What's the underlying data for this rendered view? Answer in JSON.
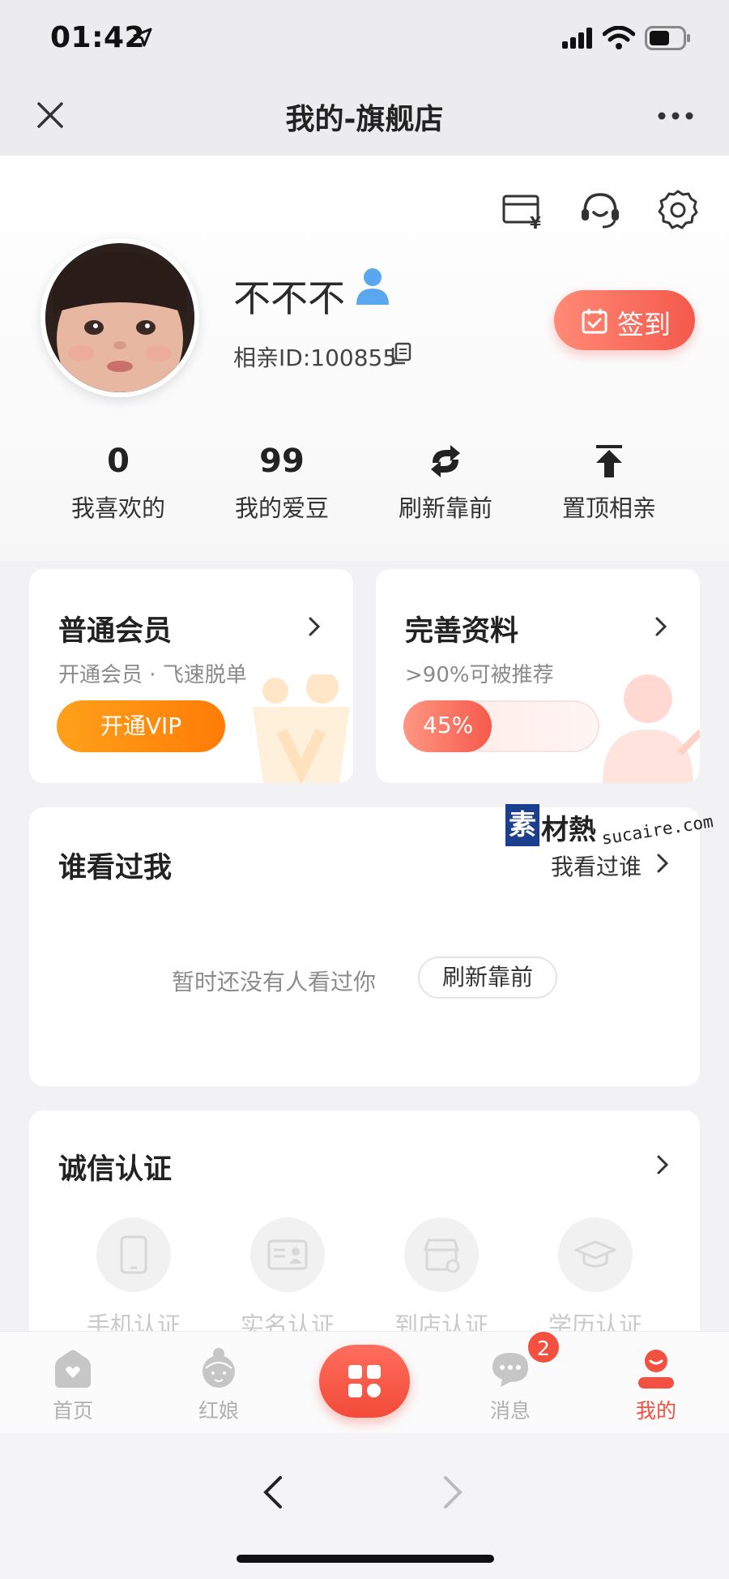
{
  "status_bar": {
    "time": "01:42"
  },
  "nav": {
    "title": "我的-旗舰店"
  },
  "profile": {
    "nickname": "不不不",
    "member_id": "相亲ID:100855",
    "checkin_label": "签到"
  },
  "stats": [
    {
      "value": "0",
      "label": "我喜欢的"
    },
    {
      "value": "99",
      "label": "我的爱豆"
    },
    {
      "icon": "refresh-icon",
      "label": "刷新靠前"
    },
    {
      "icon": "pin-top-icon",
      "label": "置顶相亲"
    }
  ],
  "membership_card": {
    "title": "普通会员",
    "subtitle": "开通会员 · 飞速脱单",
    "button": "开通VIP"
  },
  "profile_card": {
    "title": "完善资料",
    "subtitle": ">90%可被推荐",
    "progress_text": "45%",
    "progress_value": 0.45
  },
  "visitors": {
    "title": "谁看过我",
    "link": "我看过谁",
    "empty_text": "暂时还没有人看过你",
    "refresh_button": "刷新靠前"
  },
  "certification": {
    "title": "诚信认证",
    "items": [
      {
        "label": "手机认证",
        "icon": "phone-icon"
      },
      {
        "label": "实名认证",
        "icon": "id-card-icon"
      },
      {
        "label": "到店认证",
        "icon": "store-icon"
      },
      {
        "label": "学历认证",
        "icon": "graduation-cap-icon"
      }
    ]
  },
  "watermark": {
    "box": "素",
    "text": "材熱",
    "url": "sucaire.com"
  },
  "tab_bar": {
    "tabs": [
      {
        "label": "首页",
        "icon": "home-icon"
      },
      {
        "label": "红娘",
        "icon": "matchmaker-icon"
      },
      {
        "label": "消息",
        "icon": "message-icon",
        "badge": "2"
      },
      {
        "label": "我的",
        "icon": "profile-icon",
        "active": true
      }
    ]
  },
  "colors": {
    "accent": "#f4503f",
    "vip_orange": "#ff8c0f"
  }
}
